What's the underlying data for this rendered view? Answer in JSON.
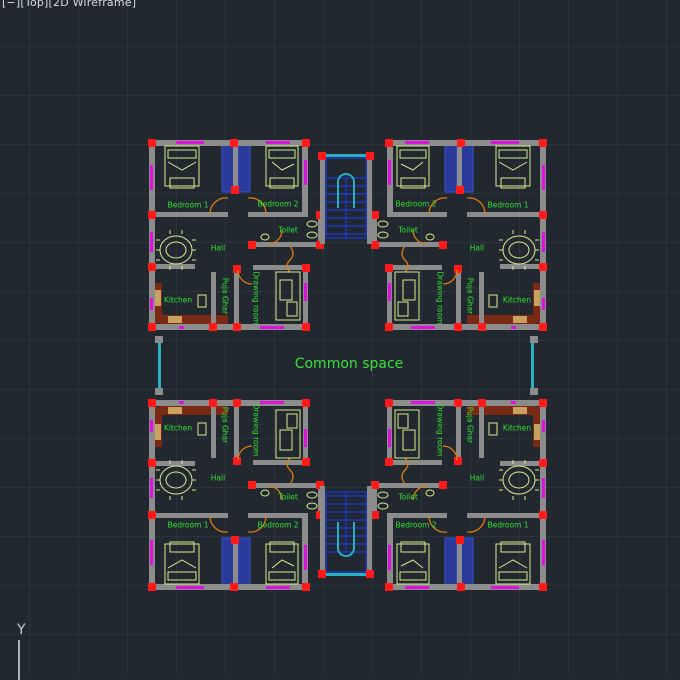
{
  "viewport": {
    "label": "[−][Top][2D Wireframe]"
  },
  "drawing": {
    "common_space": "Common space",
    "units": {
      "top_left": {
        "bedroom1": "Bedroom 1",
        "bedroom2": "Bedroom 2",
        "toilet": "Toilet",
        "hall": "Hall",
        "kitchen": "Kitchen",
        "puja": "Puja Ghar",
        "drawing": "Drawing room"
      },
      "top_right": {
        "bedroom1": "Bedroom 1",
        "bedroom2": "Bedroom 2",
        "toilet": "Toilet",
        "hall": "Hall",
        "kitchen": "Kitchen",
        "puja": "Puja Ghar",
        "drawing": "Drawing room"
      },
      "bottom_left": {
        "bedroom1": "Bedroom 1",
        "bedroom2": "Bedroom 2",
        "toilet": "Toilet",
        "hall": "Hall",
        "kitchen": "Kitchen",
        "puja": "Puja Ghar",
        "drawing": "Drawing room"
      },
      "bottom_right": {
        "bedroom1": "Bedroom 1",
        "bedroom2": "Bedroom 2",
        "toilet": "Toilet",
        "hall": "Hall",
        "kitchen": "Kitchen",
        "puja": "Puja Ghar",
        "drawing": "Drawing room"
      }
    }
  },
  "ucs": {
    "axis": "Y"
  },
  "colors": {
    "background": "#212830",
    "wall": "#8c8c8c",
    "column": "#ff1a1a",
    "window": "#e010e0",
    "furniture": "#d8ec8c",
    "label": "#33e033",
    "stair": "#1a3cff",
    "door": "#e07a10"
  }
}
